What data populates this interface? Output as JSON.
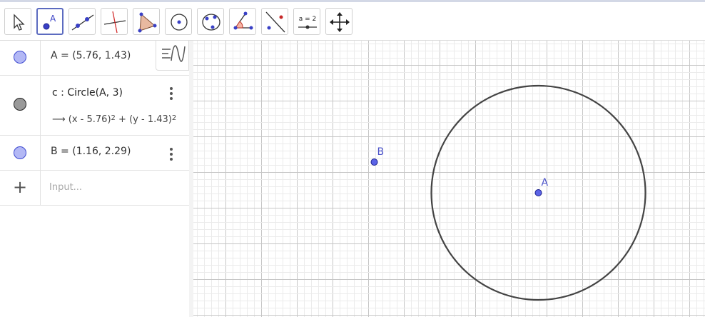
{
  "toolbar": {
    "tools": [
      {
        "name": "move-tool",
        "active": false
      },
      {
        "name": "point-tool",
        "active": true,
        "letter": "A"
      },
      {
        "name": "line-tool",
        "active": false
      },
      {
        "name": "perpendicular-line-tool",
        "active": false
      },
      {
        "name": "polygon-tool",
        "active": false
      },
      {
        "name": "circle-with-center-tool",
        "active": false
      },
      {
        "name": "circle-through-points-tool",
        "active": false
      },
      {
        "name": "angle-tool",
        "active": false
      },
      {
        "name": "reflect-tool",
        "active": false
      },
      {
        "name": "slider-tool",
        "active": false,
        "label": "a = 2"
      },
      {
        "name": "move-graphics-view-tool",
        "active": false
      }
    ]
  },
  "algebra": {
    "rows": [
      {
        "marble": "blue",
        "expression": "A = (5.76, 1.43)"
      },
      {
        "marble": "gray",
        "definition": "c : Circle(A, 3)",
        "value_arrow": "⟶",
        "value_x": "(x - 5.76)",
        "value_y": "(y - 1.43)",
        "value_op": "+",
        "exponent": "2"
      },
      {
        "marble": "blue",
        "expression": "B = (1.16, 2.29)"
      }
    ],
    "input_placeholder": "Input..."
  },
  "graphics": {
    "points": [
      {
        "label": "A",
        "x": 5.76,
        "y": 1.43
      },
      {
        "label": "B",
        "x": 1.16,
        "y": 2.29
      }
    ],
    "circle": {
      "name": "c",
      "center": "A",
      "radius": 3
    },
    "colors": {
      "point_fill": "#5b63e6",
      "point_stroke": "#1a1f8c",
      "label": "#4a52c9",
      "circle": "#444444",
      "grid_major": "#c6c6c6",
      "grid_minor": "#ebebeb"
    }
  }
}
